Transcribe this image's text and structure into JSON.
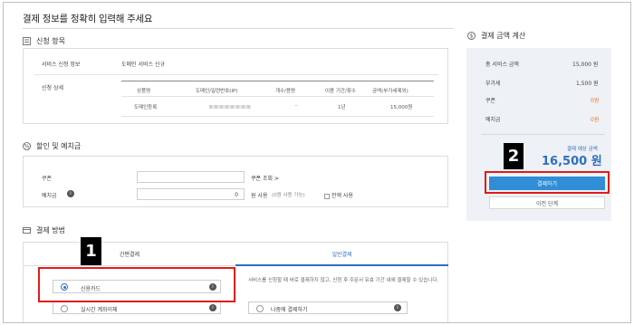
{
  "title": "결제 정보를 정확히 입력해 주세요",
  "application": {
    "heading": "신청 항목",
    "service_info_label": "서비스 신청 정보",
    "service_info_value": "도메인 서비스 신규",
    "detail_label": "신청 상세",
    "columns": [
      "상품명",
      "도메인/일련번호(IP)",
      "개수/용량",
      "이용 기간/횟수",
      "금액(부가세제외)"
    ],
    "row": {
      "product": "도메인등록",
      "count": "-",
      "period": "1년",
      "amount": "15,000원"
    }
  },
  "discount": {
    "heading": "할인 및 예치금",
    "coupon_label": "쿠폰",
    "coupon_link": "쿠폰 조회 >",
    "deposit_label": "예치금",
    "deposit_value": "0",
    "deposit_use": "원 사용",
    "deposit_available": "(0원 사용 가능)",
    "use_all": "전액 사용"
  },
  "payment_method": {
    "heading": "결제 방법",
    "tabs": [
      "간편결제",
      "일반결제"
    ],
    "options": [
      "신용카드",
      "실시간 계좌이체",
      "나중에 결제하기"
    ],
    "note": "서비스를 신청할 때 바로 결제하지 않고, 신청 후 주문서 유효 기간 내에 결제할 수 있습니다."
  },
  "summary": {
    "heading": "결제 금액 계산",
    "rows": [
      {
        "label": "총 서비스 금액",
        "value": "15,000 원"
      },
      {
        "label": "부가세",
        "value": "1,500 원"
      },
      {
        "label": "쿠폰",
        "value": "0원"
      },
      {
        "label": "예치금",
        "value": "0원"
      }
    ],
    "expected_label": "결제 예상 금액",
    "expected_value": "16,500 원",
    "pay_button": "결제하기",
    "prev_button": "이전 단계"
  },
  "callouts": [
    "1",
    "2"
  ]
}
